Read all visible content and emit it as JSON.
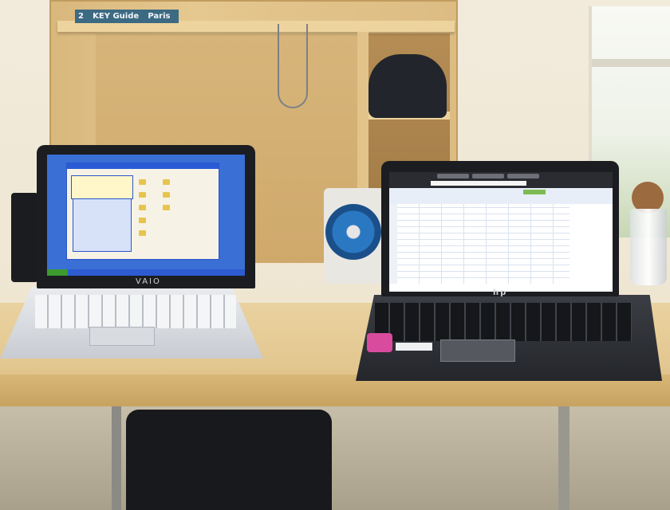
{
  "scene": {
    "description_labels": {
      "book_spine_number": "2",
      "book_spine_label": "KEY Guide",
      "book_title": "Paris",
      "left_laptop_brand": "VAIO",
      "right_laptop_brand": "hp"
    }
  },
  "colors": {
    "wood": "#e3c790",
    "vaio_desktop": "#3a6fd6",
    "hp_body": "#24262b",
    "sticker": "#d84b9d"
  }
}
